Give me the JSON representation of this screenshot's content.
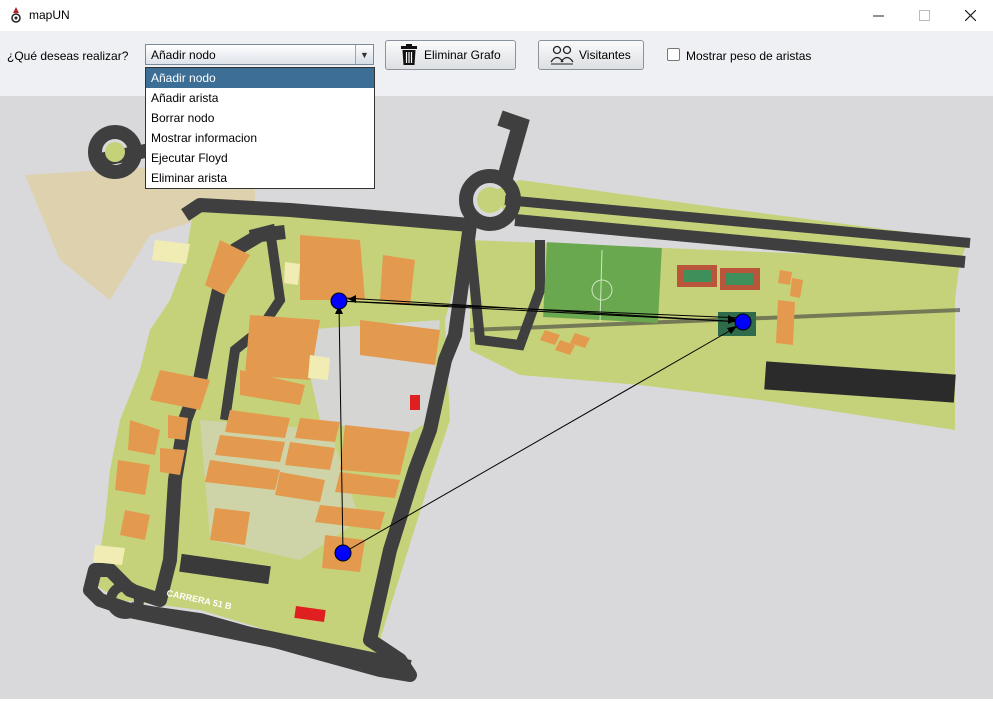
{
  "window": {
    "title": "mapUN",
    "minimize_icon": "minimize-icon",
    "maximize_icon": "maximize-icon",
    "close_icon": "close-icon"
  },
  "toolbar": {
    "question": "¿Qué deseas realizar?",
    "action_select": {
      "value": "Añadir nodo",
      "options": [
        "Añadir nodo",
        "Añadir arista",
        "Borrar nodo",
        "Mostrar informacion",
        "Ejecutar Floyd",
        "Eliminar arista"
      ]
    },
    "delete_graph_label": "Eliminar Grafo",
    "visitors_label": "Visitantes",
    "show_weights_label": "Mostrar peso de aristas",
    "show_weights_checked": false
  },
  "map": {
    "street_label": "CARRERA 51 B",
    "node_color": "#0000ff",
    "edge_color": "#000000"
  },
  "colors": {
    "toolbar_bg": "#eef0f3",
    "selection": "#3c6e96",
    "building": "#e39a4e",
    "grass": "#c6d27a",
    "road": "#3f3f3f",
    "field": "#6aa84f"
  }
}
